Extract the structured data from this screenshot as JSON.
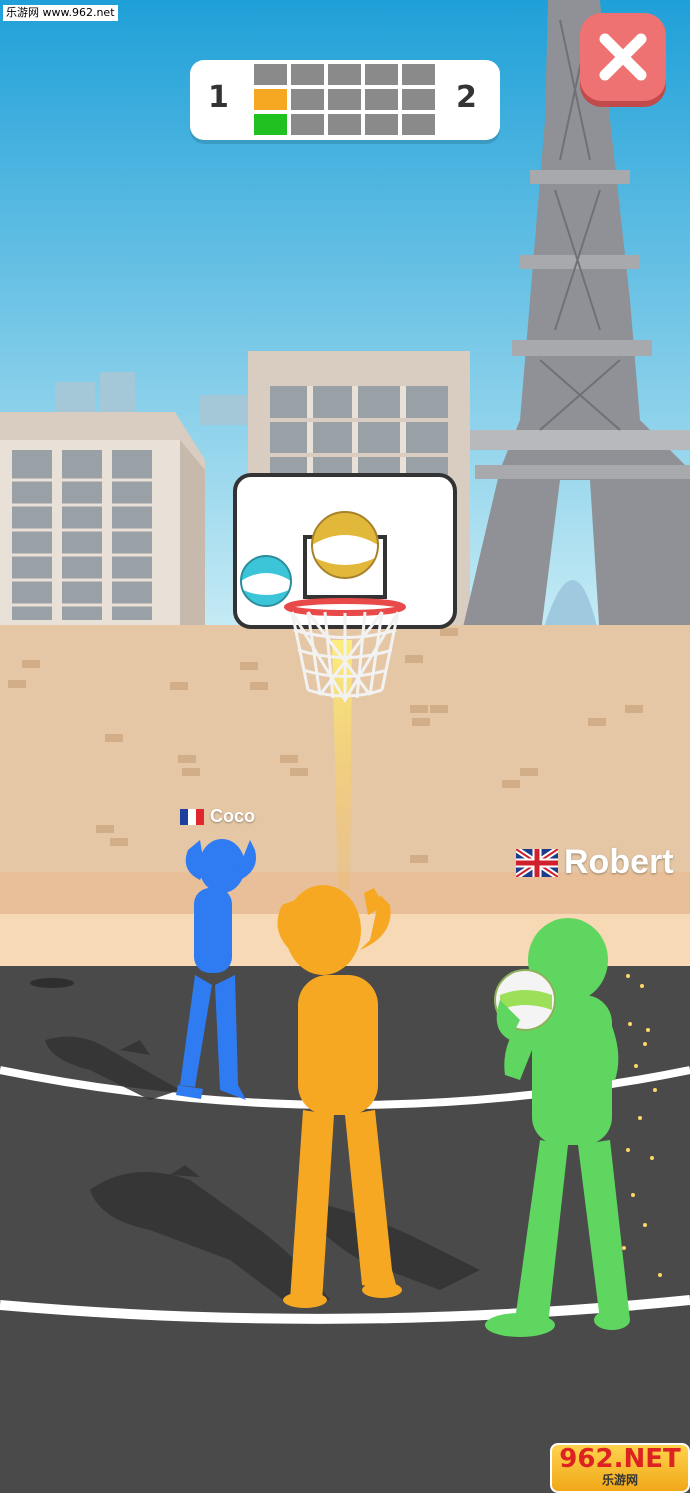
{
  "watermark": {
    "top_text": "乐游网 www.962.net",
    "bottom_text": "962.NET",
    "bottom_sub": "乐游网"
  },
  "scoreboard": {
    "left_number": "1",
    "right_number": "2",
    "rows": [
      [
        "gray",
        "gray",
        "gray",
        "gray",
        "gray"
      ],
      [
        "orange",
        "gray",
        "gray",
        "gray",
        "gray"
      ],
      [
        "green",
        "gray",
        "gray",
        "gray",
        "gray"
      ]
    ],
    "colors": {
      "gray": "#8a8a8a",
      "orange": "#f7a823",
      "green": "#22c122"
    }
  },
  "players": [
    {
      "name": "Coco",
      "flag": "france-flag-icon",
      "color": "#2f7bf2"
    },
    {
      "name": "",
      "color": "#f7a823"
    },
    {
      "name": "Robert",
      "flag": "uk-flag-icon",
      "color": "#5fd65f"
    }
  ],
  "close_button": {
    "icon": "close-icon",
    "color": "#ef7272"
  }
}
